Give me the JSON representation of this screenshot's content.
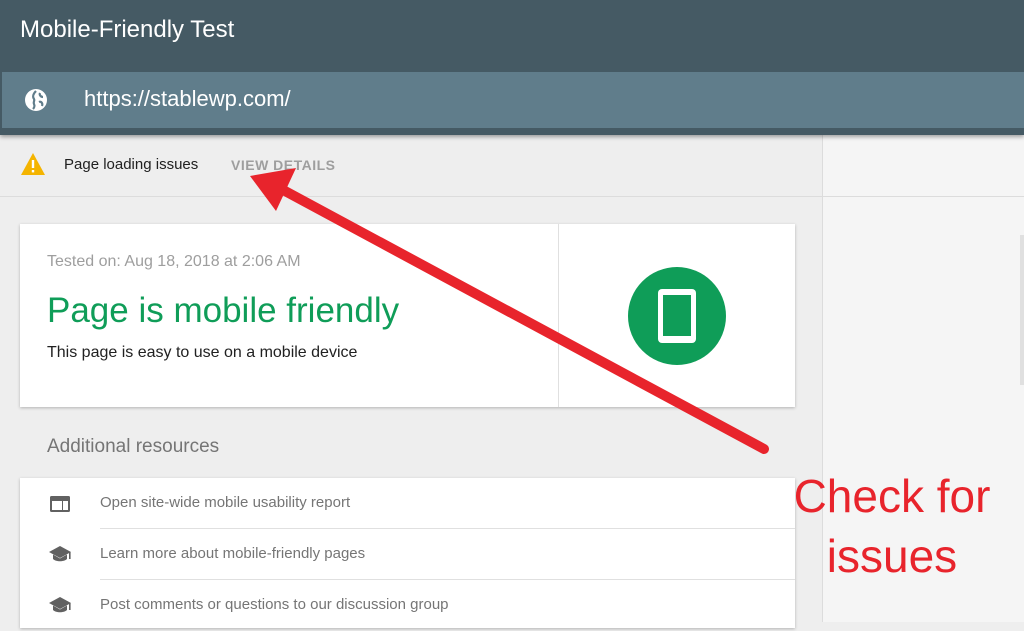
{
  "header": {
    "title": "Mobile-Friendly Test",
    "url": "https://stablewp.com/",
    "url_icon": "globe-icon"
  },
  "issue_bar": {
    "icon": "warning-icon",
    "text": "Page loading issues",
    "action_label": "VIEW DETAILS"
  },
  "result": {
    "tested_on": "Tested on: Aug 18, 2018 at 2:06 AM",
    "verdict": "Page is mobile friendly",
    "description": "This page is easy to use on a mobile device",
    "badge_icon": "mobile-phone-icon"
  },
  "resources": {
    "title": "Additional resources",
    "items": [
      {
        "icon": "web-report-icon",
        "label": "Open site-wide mobile usability report"
      },
      {
        "icon": "graduation-cap-icon",
        "label": "Learn more about mobile-friendly pages"
      },
      {
        "icon": "graduation-cap-icon",
        "label": "Post comments or questions to our discussion group"
      }
    ]
  },
  "annotation": {
    "line1": "Check for",
    "line2": "issues",
    "color": "#e8242c"
  },
  "colors": {
    "header_bg": "#455a64",
    "urlbar_bg": "#607d8b",
    "success_green": "#0f9d58",
    "warning_yellow": "#f4b400"
  }
}
